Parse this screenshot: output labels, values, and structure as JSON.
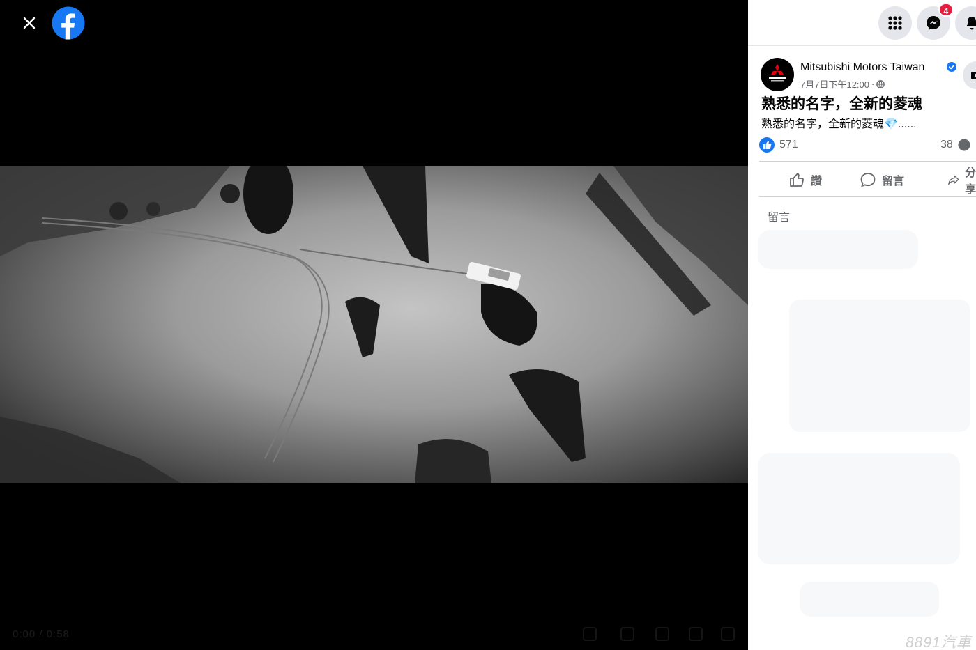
{
  "viewer": {
    "close_icon": "close-icon",
    "logo_icon": "facebook-logo-icon",
    "video_time": "0:00 / 0:58"
  },
  "topbar": {
    "menu_icon": "grid-menu-icon",
    "messenger_icon": "messenger-icon",
    "notifications_icon": "bell-icon",
    "messenger_badge": "4"
  },
  "post": {
    "page_name": "Mitsubishi Motors Taiwan",
    "timestamp": "7月7日下午12:00",
    "separator": "·",
    "privacy_icon": "globe-icon",
    "title": "熟悉的名字，全新的菱魂",
    "text": "熟悉的名字，全新的菱魂💎......",
    "like_count": "571",
    "comment_count": "38",
    "actions": {
      "like": "讚",
      "comment": "留言",
      "share": "分享"
    },
    "comments_label": "留言"
  },
  "colors": {
    "facebook_blue": "#1877f2",
    "badge_red": "#e41e3f",
    "muted_text": "#65676b"
  },
  "watermark": "8891汽車"
}
